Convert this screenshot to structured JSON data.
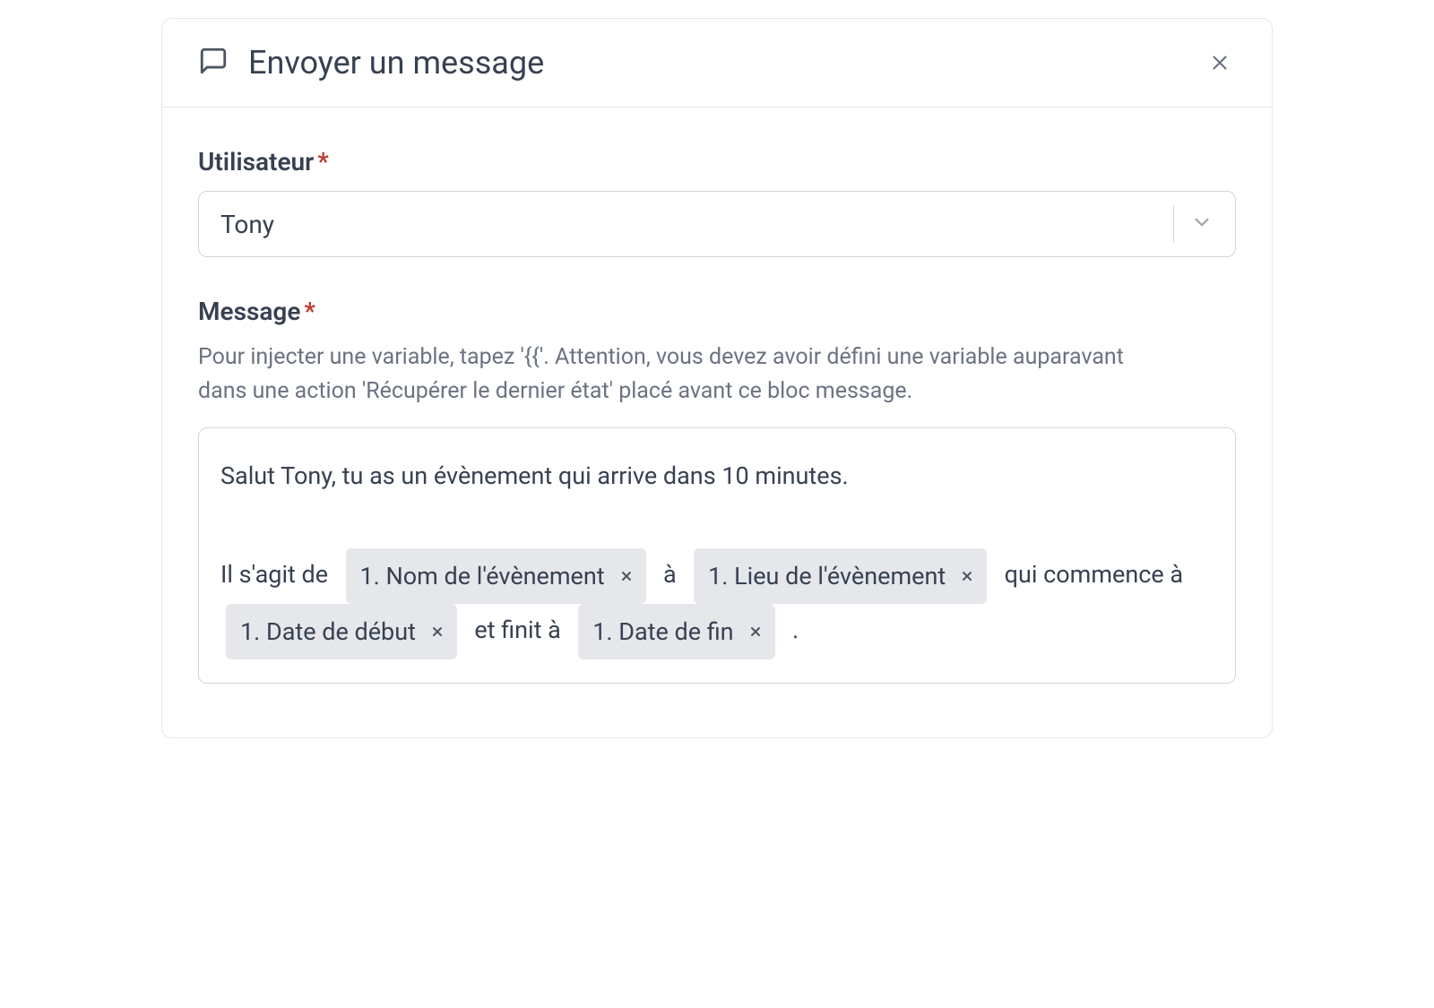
{
  "header": {
    "title": "Envoyer un message"
  },
  "user": {
    "label": "Utilisateur",
    "value": "Tony"
  },
  "message": {
    "label": "Message",
    "help": "Pour injecter une variable, tapez '{{'. Attention, vous devez avoir défini une variable auparavant dans une action 'Récupérer le dernier état' placé avant ce bloc message.",
    "content": {
      "line1": "Salut Tony, tu as un évènement qui arrive dans 10 minutes.",
      "seg1": "Il s'agit de ",
      "chip1": "1. Nom de l'évènement",
      "seg2": " à ",
      "chip2": "1. Lieu de l'évènement",
      "seg3": " qui commence à ",
      "chip3": "1. Date de début",
      "seg4": " et finit à ",
      "chip4": "1. Date de fin",
      "seg5": " ."
    }
  },
  "required_mark": "*"
}
